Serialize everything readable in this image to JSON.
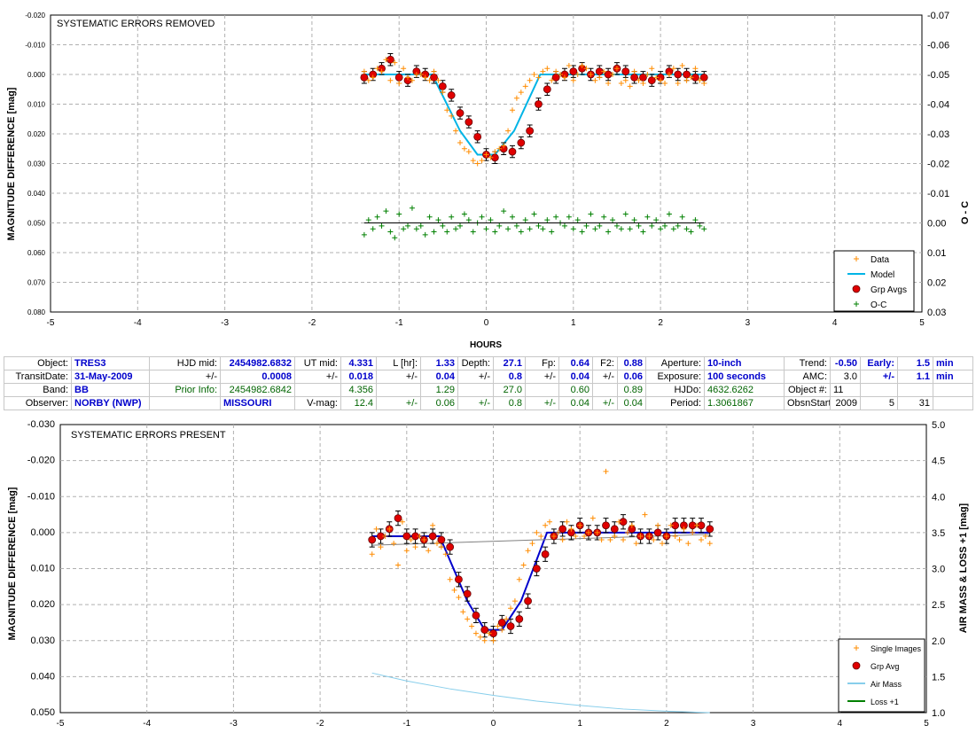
{
  "chart_data": [
    {
      "type": "scatter",
      "title": "SYSTEMATIC ERRORS REMOVED",
      "xlabel": "HOURS",
      "ylabel": "MAGNITUDE DIFFERENCE [mag]",
      "y2label": "O - C",
      "xlim": [
        -5,
        5
      ],
      "ylim": [
        -0.02,
        0.08
      ],
      "y2lim": [
        -0.07,
        0.03
      ],
      "x_ticks": [
        "-5",
        "-4",
        "-3",
        "-2",
        "-1",
        "0",
        "1",
        "2",
        "3",
        "4",
        "5"
      ],
      "y_ticks": [
        "-0.020",
        "-0.010",
        "0.000",
        "0.010",
        "0.020",
        "0.030",
        "0.040",
        "0.050",
        "0.060",
        "0.070",
        "0.080"
      ],
      "y2_ticks": [
        "-0.07",
        "-0.06",
        "-0.05",
        "-0.04",
        "-0.03",
        "-0.02",
        "-0.01",
        "0.00",
        "0.01",
        "0.02",
        "0.03"
      ],
      "grid": true,
      "legend_position": "bottom-right",
      "legend": [
        "Data",
        "Model",
        "Grp Avgs",
        "O-C"
      ],
      "series": [
        {
          "name": "Model",
          "type": "line",
          "color": "#00b4e6",
          "x": [
            -1.4,
            -0.62,
            -0.3,
            -0.1,
            0.1,
            0.32,
            0.62,
            2.5
          ],
          "y": [
            0.0,
            0.0,
            0.019,
            0.027,
            0.027,
            0.019,
            0.0,
            0.0
          ]
        },
        {
          "name": "Grp Avgs",
          "type": "scatter-errorbar",
          "color": "#e00000",
          "err": 0.002,
          "x": [
            -1.4,
            -1.3,
            -1.2,
            -1.1,
            -1.0,
            -0.9,
            -0.8,
            -0.7,
            -0.6,
            -0.5,
            -0.4,
            -0.3,
            -0.2,
            -0.1,
            0.0,
            0.1,
            0.2,
            0.3,
            0.4,
            0.5,
            0.6,
            0.7,
            0.8,
            0.9,
            1.0,
            1.1,
            1.2,
            1.3,
            1.4,
            1.5,
            1.6,
            1.7,
            1.8,
            1.9,
            2.0,
            2.1,
            2.2,
            2.3,
            2.4,
            2.5
          ],
          "y": [
            0.001,
            0.0,
            -0.002,
            -0.005,
            0.001,
            0.002,
            -0.001,
            0.0,
            0.001,
            0.004,
            0.007,
            0.013,
            0.016,
            0.021,
            0.027,
            0.028,
            0.025,
            0.026,
            0.023,
            0.019,
            0.01,
            0.005,
            0.001,
            0.0,
            -0.001,
            -0.002,
            0.0,
            -0.001,
            0.0,
            -0.002,
            -0.001,
            0.001,
            0.001,
            0.002,
            0.001,
            -0.001,
            0.0,
            0.0,
            0.001,
            0.001
          ]
        },
        {
          "name": "Data",
          "type": "scatter",
          "color": "#ff8c00",
          "marker": "+",
          "x": [
            -1.4,
            -1.35,
            -1.3,
            -1.25,
            -1.2,
            -1.15,
            -1.1,
            -1.05,
            -1.0,
            -0.95,
            -0.9,
            -0.85,
            -0.8,
            -0.75,
            -0.7,
            -0.65,
            -0.6,
            -0.55,
            -0.5,
            -0.45,
            -0.4,
            -0.35,
            -0.3,
            -0.25,
            -0.2,
            -0.15,
            -0.1,
            -0.05,
            0.0,
            0.05,
            0.1,
            0.15,
            0.2,
            0.25,
            0.3,
            0.35,
            0.4,
            0.45,
            0.5,
            0.55,
            0.6,
            0.65,
            0.7,
            0.75,
            0.8,
            0.85,
            0.9,
            0.95,
            1.0,
            1.05,
            1.1,
            1.15,
            1.2,
            1.25,
            1.3,
            1.35,
            1.4,
            1.45,
            1.5,
            1.55,
            1.6,
            1.65,
            1.7,
            1.75,
            1.8,
            1.85,
            1.9,
            1.95,
            2.0,
            2.05,
            2.1,
            2.15,
            2.2,
            2.25,
            2.3,
            2.35,
            2.4,
            2.45,
            2.5
          ],
          "y": [
            -0.001,
            0.002,
            0.001,
            -0.002,
            -0.001,
            -0.005,
            0.002,
            -0.004,
            0.003,
            -0.002,
            0.001,
            0.002,
            0.0,
            0.0,
            0.001,
            0.002,
            -0.001,
            0.002,
            0.006,
            0.012,
            0.014,
            0.019,
            0.023,
            0.025,
            0.026,
            0.029,
            0.03,
            0.029,
            0.027,
            0.028,
            0.026,
            0.025,
            0.024,
            0.019,
            0.012,
            0.008,
            0.006,
            0.004,
            0.002,
            0.0,
            0.001,
            -0.001,
            -0.002,
            0.002,
            -0.001,
            0.0,
            0.001,
            -0.003,
            0.002,
            0.0,
            -0.003,
            -0.002,
            0.0,
            0.002,
            0.001,
            -0.001,
            0.003,
            0.0,
            -0.002,
            0.003,
            0.002,
            0.004,
            -0.001,
            0.002,
            0.003,
            0.0,
            -0.002,
            0.001,
            0.002,
            0.003,
            0.0,
            -0.002,
            0.003,
            -0.003,
            0.002,
            0.001,
            -0.002,
            0.002,
            0.003
          ]
        },
        {
          "name": "O-C",
          "type": "scatter",
          "color": "#008000",
          "marker": "+",
          "axis": "y2",
          "x": [
            -1.4,
            -1.35,
            -1.3,
            -1.25,
            -1.2,
            -1.15,
            -1.1,
            -1.05,
            -1.0,
            -0.95,
            -0.9,
            -0.85,
            -0.8,
            -0.75,
            -0.7,
            -0.65,
            -0.6,
            -0.55,
            -0.5,
            -0.45,
            -0.4,
            -0.35,
            -0.3,
            -0.25,
            -0.2,
            -0.15,
            -0.1,
            -0.05,
            0.0,
            0.05,
            0.1,
            0.15,
            0.2,
            0.25,
            0.3,
            0.35,
            0.4,
            0.45,
            0.5,
            0.55,
            0.6,
            0.65,
            0.7,
            0.75,
            0.8,
            0.85,
            0.9,
            0.95,
            1.0,
            1.05,
            1.1,
            1.15,
            1.2,
            1.25,
            1.3,
            1.35,
            1.4,
            1.45,
            1.5,
            1.55,
            1.6,
            1.65,
            1.7,
            1.75,
            1.8,
            1.85,
            1.9,
            1.95,
            2.0,
            2.05,
            2.1,
            2.15,
            2.2,
            2.25,
            2.3,
            2.35,
            2.4,
            2.45,
            2.5
          ],
          "y": [
            0.004,
            -0.001,
            0.002,
            -0.002,
            0.001,
            -0.004,
            0.003,
            0.005,
            -0.003,
            0.002,
            0.001,
            -0.005,
            0.002,
            0.001,
            0.004,
            -0.002,
            0.003,
            -0.001,
            0.001,
            0.003,
            -0.002,
            0.002,
            0.001,
            -0.003,
            -0.001,
            0.003,
            0.0,
            -0.002,
            0.002,
            -0.001,
            0.003,
            0.001,
            -0.004,
            0.002,
            -0.002,
            0.001,
            0.003,
            -0.001,
            0.002,
            -0.003,
            0.001,
            0.002,
            -0.001,
            0.003,
            -0.002,
            0.0,
            0.001,
            -0.002,
            0.002,
            -0.001,
            0.003,
            0.001,
            -0.003,
            0.002,
            0.001,
            -0.002,
            0.003,
            -0.001,
            0.001,
            0.002,
            -0.003,
            0.002,
            -0.001,
            0.001,
            0.003,
            -0.002,
            0.001,
            -0.001,
            0.002,
            0.001,
            -0.003,
            0.002,
            0.001,
            -0.002,
            0.002,
            0.003,
            -0.001,
            0.001,
            0.002
          ]
        },
        {
          "name": "O-C baseline",
          "type": "line",
          "color": "#000000",
          "axis": "y2",
          "x": [
            -1.4,
            2.5
          ],
          "y": [
            0.0,
            0.0
          ]
        }
      ]
    },
    {
      "type": "scatter",
      "title": "SYSTEMATIC ERRORS PRESENT",
      "xlabel": "",
      "ylabel": "MAGNITUDE DIFFERENCE [mag]",
      "y2label": "AIR MASS & LOSS +1 [mag]",
      "xlim": [
        -5,
        5
      ],
      "ylim": [
        -0.03,
        0.05
      ],
      "y2lim": [
        5.0,
        1.0
      ],
      "x_ticks": [
        "-5",
        "-4",
        "-3",
        "-2",
        "-1",
        "0",
        "1",
        "2",
        "3",
        "4",
        "5"
      ],
      "y_ticks": [
        "-0.030",
        "-0.020",
        "-0.010",
        "0.000",
        "0.010",
        "0.020",
        "0.030",
        "0.040",
        "0.050"
      ],
      "y2_ticks": [
        "5.0",
        "4.5",
        "4.0",
        "3.5",
        "3.0",
        "2.5",
        "2.0",
        "1.5",
        "1.0"
      ],
      "grid": true,
      "legend_position": "bottom-right",
      "legend": [
        "Single Images",
        "Grp Avg",
        "Air Mass",
        "Loss +1"
      ],
      "series": [
        {
          "name": "Model",
          "type": "line",
          "color": "#0000cc",
          "x": [
            -1.4,
            -0.62,
            -0.3,
            -0.1,
            0.1,
            0.32,
            0.62,
            2.5
          ],
          "y": [
            0.001,
            0.001,
            0.019,
            0.027,
            0.027,
            0.019,
            0.0,
            0.0
          ]
        },
        {
          "name": "Trend",
          "type": "line",
          "color": "#808080",
          "x": [
            -1.4,
            2.5
          ],
          "y": [
            0.0035,
            0.0005
          ]
        },
        {
          "name": "Air Mass",
          "type": "line",
          "color": "#87ceeb",
          "axis": "y2",
          "x": [
            -1.4,
            -1.0,
            -0.5,
            0.0,
            0.5,
            1.0,
            1.5,
            2.0,
            2.5
          ],
          "y": [
            1.55,
            1.44,
            1.33,
            1.24,
            1.16,
            1.1,
            1.05,
            1.02,
            1.0
          ]
        },
        {
          "name": "Grp Avg",
          "type": "scatter-errorbar",
          "color": "#e00000",
          "err": 0.002,
          "x": [
            -1.4,
            -1.3,
            -1.2,
            -1.1,
            -1.0,
            -0.9,
            -0.8,
            -0.7,
            -0.6,
            -0.5,
            -0.4,
            -0.3,
            -0.2,
            -0.1,
            0.0,
            0.1,
            0.2,
            0.3,
            0.4,
            0.5,
            0.6,
            0.7,
            0.8,
            0.9,
            1.0,
            1.1,
            1.2,
            1.3,
            1.4,
            1.5,
            1.6,
            1.7,
            1.8,
            1.9,
            2.0,
            2.1,
            2.2,
            2.3,
            2.4,
            2.5
          ],
          "y": [
            0.002,
            0.001,
            -0.001,
            -0.004,
            0.001,
            0.001,
            0.002,
            0.001,
            0.002,
            0.004,
            0.013,
            0.017,
            0.023,
            0.027,
            0.028,
            0.025,
            0.026,
            0.024,
            0.019,
            0.01,
            0.006,
            0.001,
            -0.001,
            0.0,
            -0.002,
            0.0,
            0.0,
            -0.002,
            -0.001,
            -0.003,
            -0.001,
            0.001,
            0.001,
            0.0,
            0.001,
            -0.002,
            -0.002,
            -0.002,
            -0.002,
            -0.001
          ]
        },
        {
          "name": "Single Images",
          "type": "scatter",
          "color": "#ff8c00",
          "marker": "+",
          "x": [
            -1.4,
            -1.35,
            -1.3,
            -1.25,
            -1.2,
            -1.15,
            -1.1,
            -1.05,
            -1.0,
            -0.95,
            -0.9,
            -0.85,
            -0.8,
            -0.75,
            -0.7,
            -0.65,
            -0.6,
            -0.55,
            -0.5,
            -0.45,
            -0.4,
            -0.35,
            -0.3,
            -0.25,
            -0.2,
            -0.15,
            -0.1,
            -0.05,
            0.0,
            0.05,
            0.1,
            0.15,
            0.2,
            0.25,
            0.3,
            0.35,
            0.4,
            0.45,
            0.5,
            0.55,
            0.6,
            0.65,
            0.7,
            0.75,
            0.8,
            0.85,
            0.9,
            0.95,
            1.0,
            1.05,
            1.1,
            1.15,
            1.2,
            1.25,
            1.3,
            1.35,
            1.4,
            1.45,
            1.5,
            1.55,
            1.6,
            1.65,
            1.7,
            1.75,
            1.8,
            1.85,
            1.9,
            1.95,
            2.0,
            2.05,
            2.1,
            2.15,
            2.2,
            2.25,
            2.3,
            2.35,
            2.4,
            2.45,
            2.5
          ],
          "y": [
            0.006,
            -0.001,
            0.004,
            0.001,
            -0.001,
            0.003,
            0.009,
            -0.003,
            0.005,
            0.002,
            0.004,
            0.001,
            0.002,
            0.005,
            -0.002,
            0.003,
            0.004,
            0.006,
            0.013,
            0.016,
            0.018,
            0.022,
            0.024,
            0.026,
            0.028,
            0.029,
            0.03,
            0.028,
            0.03,
            0.026,
            0.027,
            0.024,
            0.021,
            0.019,
            0.013,
            0.009,
            0.005,
            0.003,
            0.0,
            0.001,
            -0.002,
            -0.003,
            0.001,
            0.0,
            0.002,
            -0.003,
            -0.001,
            0.001,
            -0.002,
            0.001,
            0.0,
            -0.004,
            0.0,
            0.002,
            -0.017,
            0.002,
            0.001,
            -0.003,
            0.002,
            0.0,
            -0.002,
            0.003,
            0.001,
            -0.005,
            0.001,
            0.002,
            -0.002,
            0.003,
            0.001,
            -0.002,
            0.001,
            0.002,
            -0.001,
            0.003,
            0.0,
            -0.002,
            0.002,
            0.001,
            0.003
          ]
        }
      ]
    }
  ],
  "info_table": {
    "rows": [
      [
        "Object:",
        "TRES3",
        "HJD mid:",
        "2454982.6832",
        "UT mid:",
        "4.331",
        "L [hr]:",
        "1.33",
        "Depth:",
        "27.1",
        "Fp:",
        "0.64",
        "F2:",
        "0.88",
        "Aperture:",
        "10-inch",
        "Trend:",
        "-0.50",
        "Early:",
        "1.5",
        "min"
      ],
      [
        "TransitDate:",
        "31-May-2009",
        "+/-",
        "0.0008",
        "+/-",
        "0.018",
        "+/-",
        "0.04",
        "+/-",
        "0.8",
        "+/-",
        "0.04",
        "+/-",
        "0.06",
        "Exposure:",
        "100 seconds",
        "AMC:",
        "3.0",
        "+/-",
        "1.1",
        "min"
      ],
      [
        "Band:",
        "BB",
        "Prior Info:",
        "2454982.6842",
        "",
        "4.356",
        "",
        "1.29",
        "",
        "27.0",
        "",
        "0.60",
        "",
        "0.89",
        "HJDo:",
        "4632.6262",
        "Object #:",
        "11",
        "",
        "",
        ""
      ],
      [
        "Observer:",
        "NORBY (NWP)",
        "",
        "MISSOURI",
        "V-mag:",
        "12.4",
        "+/-",
        "0.06",
        "+/-",
        "0.8",
        "+/-",
        "0.04",
        "+/-",
        "0.04",
        "Period:",
        "1.3061867",
        "ObsnStartDate:",
        "2009",
        "5",
        "31",
        ""
      ]
    ],
    "row_classes": [
      [
        "lbl",
        "blu",
        "lbl",
        "bluR",
        "lbl",
        "bluR",
        "lbl",
        "bluR",
        "lbl",
        "bluR",
        "lbl",
        "bluR",
        "lbl",
        "bluR",
        "lbl",
        "blu",
        "lbl",
        "bluR",
        "bluR",
        "bluR",
        "blu"
      ],
      [
        "lbl",
        "blu",
        "lbl",
        "bluR",
        "lbl",
        "bluR",
        "lbl",
        "bluR",
        "lbl",
        "bluR",
        "lbl",
        "bluR",
        "lbl",
        "bluR",
        "lbl",
        "blu",
        "lbl",
        "blkR",
        "bluR",
        "bluR",
        "blu"
      ],
      [
        "lbl",
        "blu",
        "grnR",
        "grnR",
        "lbl",
        "grnR",
        "lbl",
        "grnR",
        "lbl",
        "grnR",
        "lbl",
        "grnR",
        "lbl",
        "grnR",
        "lbl",
        "grnL",
        "lbl",
        "blk",
        "blk",
        "blk",
        "blk"
      ],
      [
        "lbl",
        "blu",
        "lbl",
        "blu",
        "lbl",
        "grnR",
        "grnR",
        "grnR",
        "grnR",
        "grnR",
        "grnR",
        "grnR",
        "grnR",
        "grnR",
        "lbl",
        "grnL",
        "lbl",
        "blkR",
        "blkR",
        "blkR",
        "blk"
      ]
    ]
  }
}
